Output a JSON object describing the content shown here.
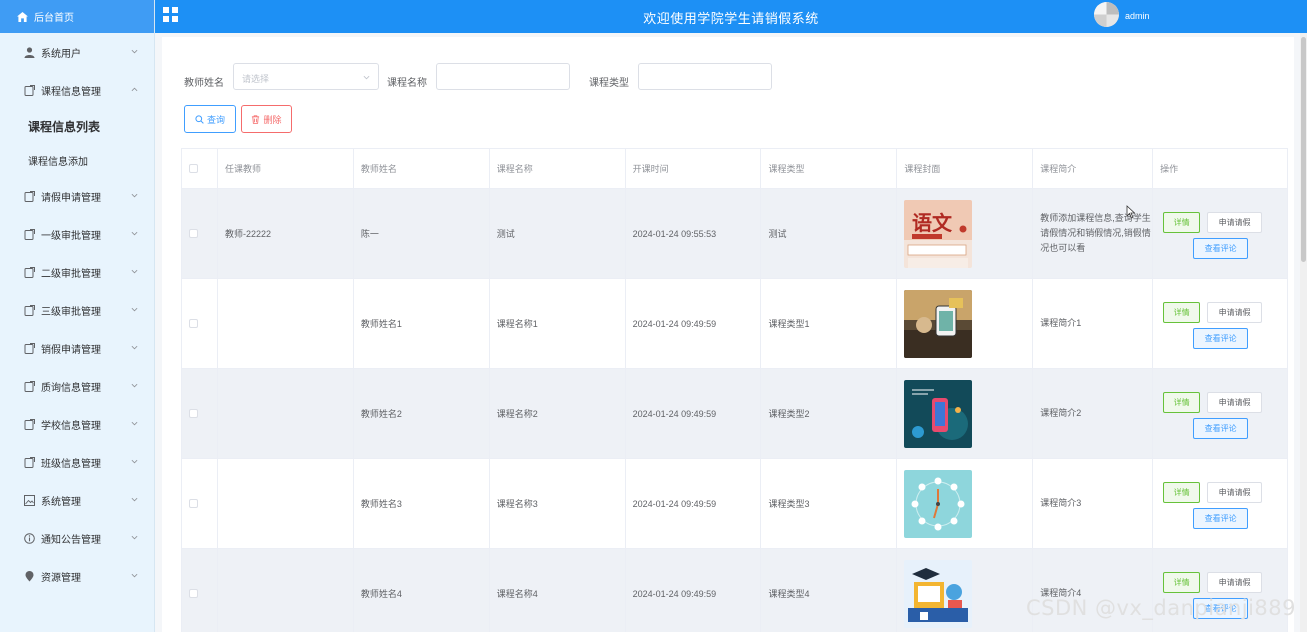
{
  "app": {
    "title": "欢迎使用学院学生请销假系统",
    "user": "admin"
  },
  "sidebar": {
    "home": "后台首页",
    "items": [
      {
        "label": "系统用户",
        "icon": "user-icon"
      },
      {
        "label": "课程信息管理",
        "icon": "doc-icon",
        "expanded": true
      },
      {
        "label": "请假申请管理",
        "icon": "doc-icon"
      },
      {
        "label": "一级审批管理",
        "icon": "doc-icon"
      },
      {
        "label": "二级审批管理",
        "icon": "doc-icon"
      },
      {
        "label": "三级审批管理",
        "icon": "doc-icon"
      },
      {
        "label": "销假申请管理",
        "icon": "doc-icon"
      },
      {
        "label": "质询信息管理",
        "icon": "doc-icon"
      },
      {
        "label": "学校信息管理",
        "icon": "doc-icon"
      },
      {
        "label": "班级信息管理",
        "icon": "doc-icon"
      },
      {
        "label": "系统管理",
        "icon": "picture-icon"
      },
      {
        "label": "通知公告管理",
        "icon": "info-icon"
      },
      {
        "label": "资源管理",
        "icon": "location-icon"
      }
    ],
    "subitems": [
      "课程信息列表",
      "课程信息添加"
    ]
  },
  "filters": {
    "teacher_label": "教师姓名",
    "teacher_placeholder": "请选择",
    "course_label": "课程名称",
    "type_label": "课程类型",
    "query_button": "查询",
    "delete_button": "删除"
  },
  "table": {
    "headers": [
      "任课教师",
      "教师姓名",
      "课程名称",
      "开课时间",
      "课程类型",
      "课程封面",
      "课程简介",
      "操作"
    ],
    "ops": {
      "detail": "详情",
      "apply": "申请请假",
      "review": "查看评论"
    },
    "rows": [
      {
        "teacher_id": "教师-22222",
        "teacher_name": "陈一",
        "course": "测试",
        "time": "2024-01-24 09:55:53",
        "type": "测试",
        "cover": "chinese-cover",
        "intro": "教师添加课程信息,查询学生请假情况和销假情况,销假情况也可以看"
      },
      {
        "teacher_id": "",
        "teacher_name": "教师姓名1",
        "course": "课程名称1",
        "time": "2024-01-24 09:49:59",
        "type": "课程类型1",
        "cover": "photo-cover",
        "intro": "课程简介1"
      },
      {
        "teacher_id": "",
        "teacher_name": "教师姓名2",
        "course": "课程名称2",
        "time": "2024-01-24 09:49:59",
        "type": "课程类型2",
        "cover": "phone-cover",
        "intro": "课程简介2"
      },
      {
        "teacher_id": "",
        "teacher_name": "教师姓名3",
        "course": "课程名称3",
        "time": "2024-01-24 09:49:59",
        "type": "课程类型3",
        "cover": "clock-cover",
        "intro": "课程简介3"
      },
      {
        "teacher_id": "",
        "teacher_name": "教师姓名4",
        "course": "课程名称4",
        "time": "2024-01-24 09:49:59",
        "type": "课程类型4",
        "cover": "study-cover",
        "intro": "课程简介4"
      }
    ]
  },
  "watermark": "CSDN @vx_danpianji889",
  "colors": {
    "topbar": "#1d90f5",
    "sidebar": "#e8f4fd",
    "primary": "#409eff",
    "danger": "#f56c6c",
    "success": "#67c23a"
  }
}
